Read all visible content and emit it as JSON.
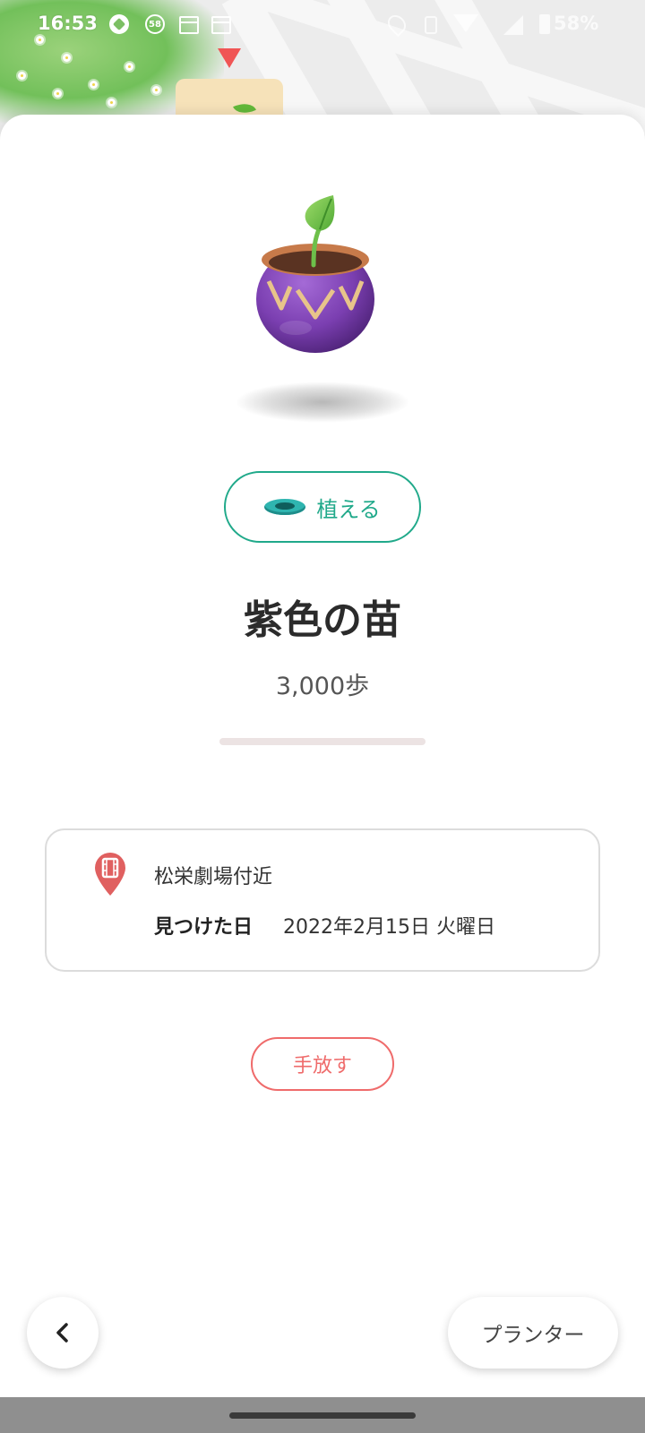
{
  "status_bar": {
    "time": "16:53",
    "notification_badge": "58",
    "battery": "58%",
    "icons": [
      "game-icon",
      "badge-58-icon",
      "calendar-icon",
      "calendar-icon",
      "location-icon",
      "vibrate-icon",
      "wifi-icon",
      "signal-icon",
      "battery-icon"
    ]
  },
  "item": {
    "plant_button_label": "植える",
    "name": "紫色の苗",
    "steps": "3,000歩",
    "progress_fraction": 0.0
  },
  "info": {
    "location": "松栄劇場付近",
    "found_date_label": "見つけた日",
    "found_date": "2022年2月15日 火曜日"
  },
  "actions": {
    "release_label": "手放す",
    "planner_label": "プランター"
  },
  "colors": {
    "accent_green": "#20a98a",
    "release_red": "#ef6b6b",
    "pot_purple": "#7b3fb1",
    "pin_red": "#e06060"
  }
}
